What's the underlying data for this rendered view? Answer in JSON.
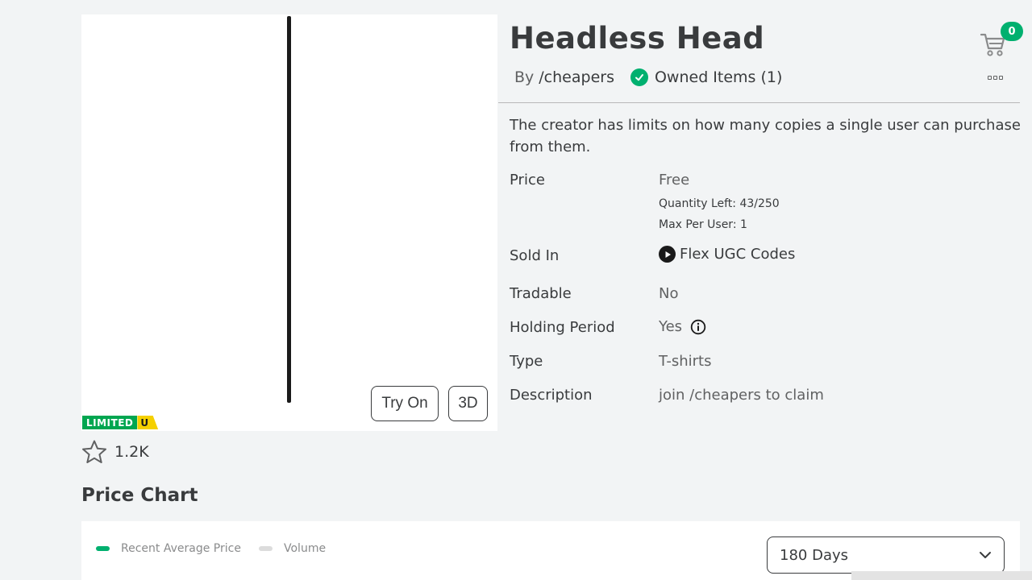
{
  "item": {
    "title": "Headless Head",
    "by_label": "By",
    "creator": "/cheapers",
    "owned": "Owned Items (1)",
    "limited_badge": "LIMITED",
    "limited_u": "U",
    "favorites": "1.2K"
  },
  "thumbnail": {
    "try_on": "Try On",
    "view_3d": "3D"
  },
  "cart": {
    "count": "0"
  },
  "notice": "The creator has limits on how many copies a single user can purchase from them.",
  "details": {
    "price_label": "Price",
    "price_value": "Free",
    "quantity_left": "Quantity Left: 43/250",
    "max_per_user": "Max Per User: 1",
    "sold_in_label": "Sold In",
    "sold_in_value": "Flex UGC Codes",
    "tradable_label": "Tradable",
    "tradable_value": "No",
    "holding_label": "Holding Period",
    "holding_value": "Yes",
    "type_label": "Type",
    "type_value": "T-shirts",
    "description_label": "Description",
    "description_value": "join /cheapers to claim"
  },
  "price_chart": {
    "title": "Price Chart",
    "legend_price": "Recent Average Price",
    "legend_volume": "Volume",
    "range_selected": "180 Days"
  },
  "colors": {
    "accent_green": "#00b06f",
    "limited_green": "#00a650",
    "limited_yellow": "#f5d000",
    "text_primary": "#393b3d",
    "background": "#f2f4f5"
  }
}
